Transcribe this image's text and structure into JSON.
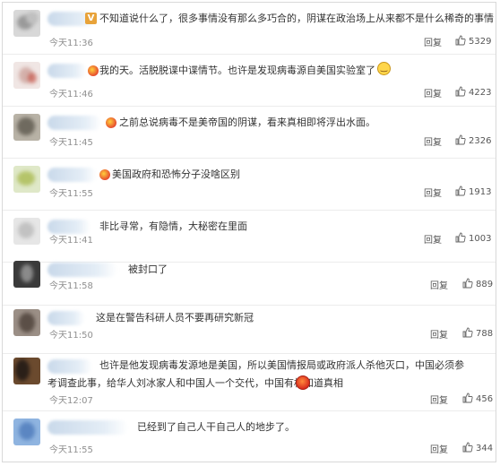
{
  "reply_label": "回复",
  "comments": [
    {
      "text": "不知道说什么了，很多事情没有那么多巧合的，阴谋在政治场上从来都不是什么稀奇的事情",
      "time": "今天11:36",
      "likes": "5329",
      "badge_letter": "V"
    },
    {
      "text": "我的天。活脱脱谍中谍情节。也许是发现病毒源自美国实验室了",
      "time": "今天11:46",
      "likes": "4223"
    },
    {
      "text": "之前总说病毒不是美帝国的阴谋，看来真相即将浮出水面。",
      "time": "今天11:45",
      "likes": "2326"
    },
    {
      "text": "美国政府和恐怖分子没啥区别",
      "time": "今天11:55",
      "likes": "1913"
    },
    {
      "text": "非比寻常，有隐情，大秘密在里面",
      "time": "今天11:41",
      "likes": "1003"
    },
    {
      "text": "被封口了",
      "time": "今天11:58",
      "likes": "889"
    },
    {
      "text": "这是在警告科研人员不要再研究新冠",
      "time": "今天11:50",
      "likes": "788"
    },
    {
      "text": "也许是他发现病毒发源地是美国，所以美国情报局或政府派人杀他灭口，中国必须参考调查此事，给华人刘冰家人和中国人一个交代，中国有权知道真相",
      "time": "今天12:07",
      "likes": "456"
    },
    {
      "text": "已经到了自己人干自己人的地步了。",
      "time": "今天11:55",
      "likes": "344"
    }
  ],
  "colors": {
    "accent_badge": "#e8a33a",
    "time": "#8f8f8f",
    "text": "#333333"
  },
  "icons": [
    "avatar",
    "verified-badge-icon",
    "medal-badge-icon",
    "smiley-emoji-icon",
    "angry-face-emoji-icon",
    "thumbs-up-icon"
  ]
}
